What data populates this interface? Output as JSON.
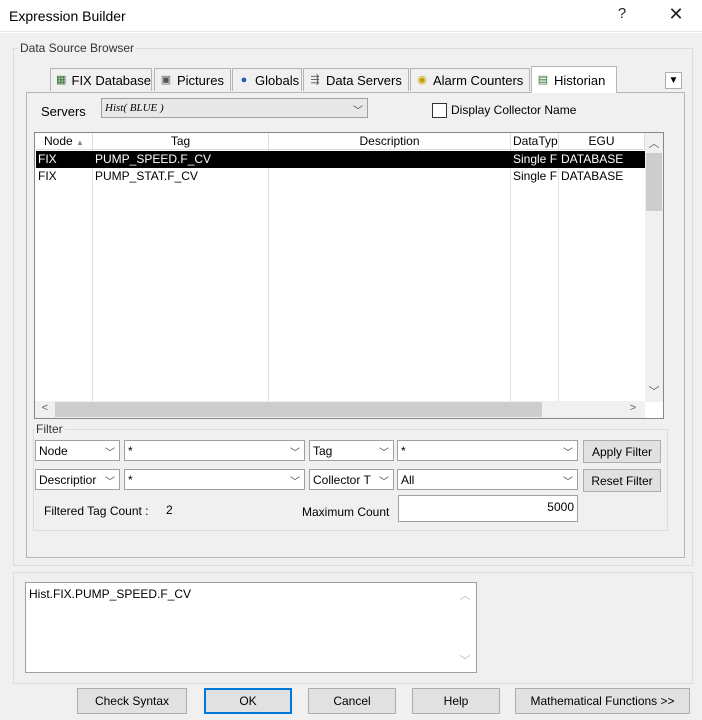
{
  "window": {
    "title": "Expression Builder",
    "help_glyph": "?",
    "close_glyph": "✕"
  },
  "browser": {
    "label": "Data Source Browser"
  },
  "tabs": [
    {
      "label": "FIX Database",
      "icon": "database-icon",
      "active": false
    },
    {
      "label": "Pictures",
      "icon": "monitor-icon",
      "active": false
    },
    {
      "label": "Globals",
      "icon": "globe-icon",
      "active": false
    },
    {
      "label": "Data Servers",
      "icon": "data-server-icon",
      "active": false
    },
    {
      "label": "Alarm Counters",
      "icon": "alarm-counter-icon",
      "active": false
    },
    {
      "label": "Historian",
      "icon": "historian-icon",
      "active": true
    }
  ],
  "servers": {
    "label": "Servers",
    "value": "Hist( BLUE )"
  },
  "display_collector": {
    "label": "Display Collector Name",
    "checked": false
  },
  "list": {
    "columns": [
      "Node",
      "Tag",
      "Description",
      "DataTyp",
      "EGU"
    ],
    "rows": [
      {
        "node": "FIX",
        "tag": "PUMP_SPEED.F_CV",
        "description": "",
        "datatype": "Single F",
        "egu": "DATABASE",
        "selected": true
      },
      {
        "node": "FIX",
        "tag": "PUMP_STAT.F_CV",
        "description": "",
        "datatype": "Single F",
        "egu": "DATABASE",
        "selected": false
      }
    ]
  },
  "filter": {
    "label": "Filter",
    "field1": {
      "label": "Node",
      "value": "*"
    },
    "field2": {
      "label": "Tag",
      "value": "*"
    },
    "field3": {
      "label": "Descriptior",
      "value": "*"
    },
    "field4": {
      "label": "Collector T",
      "value": "All"
    },
    "apply_label": "Apply Filter",
    "reset_label": "Reset Filter",
    "count_label": "Filtered Tag Count :",
    "count_value": "2",
    "max_label": "Maximum Count",
    "max_value": "5000"
  },
  "expression": {
    "value": "Hist.FIX.PUMP_SPEED.F_CV"
  },
  "buttons": {
    "check_syntax": "Check Syntax",
    "ok": "OK",
    "cancel": "Cancel",
    "help": "Help",
    "math_functions": "Mathematical  Functions  >>"
  },
  "icons": {
    "dropdown": "chevron-down-icon",
    "overflow": "overflow-menu-icon"
  }
}
